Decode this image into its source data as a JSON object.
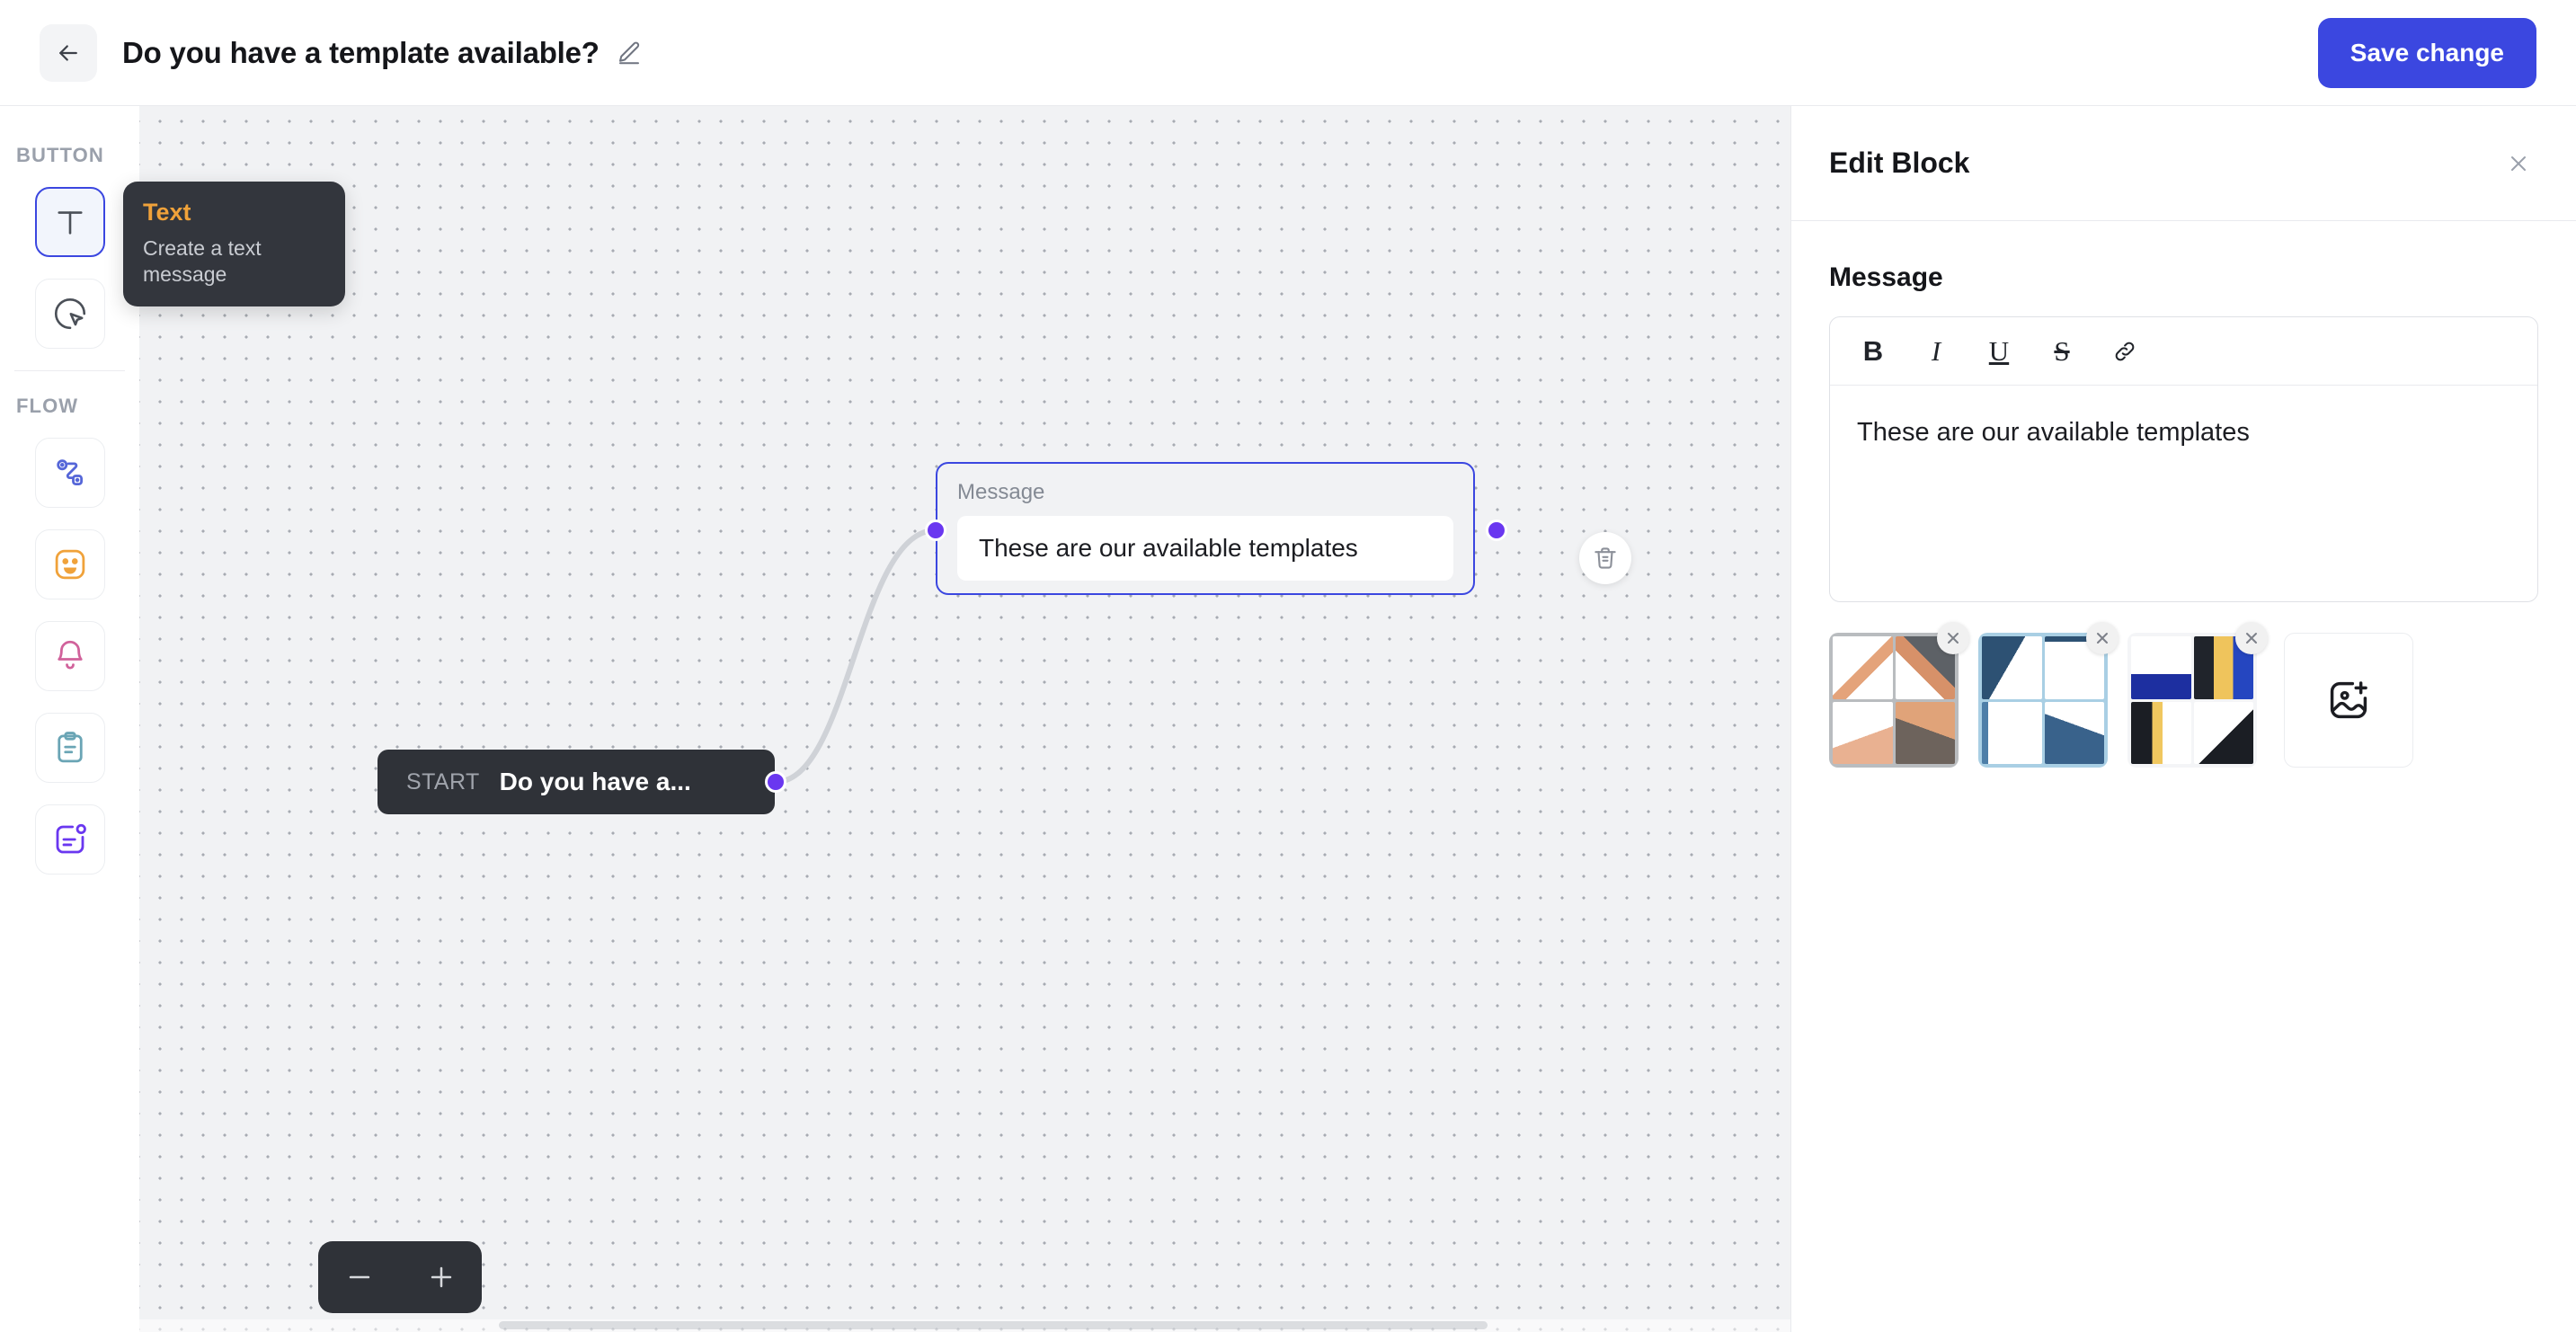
{
  "topbar": {
    "back_icon": "arrow-left-icon",
    "title": "Do you have a template available?",
    "edit_icon": "pencil-icon",
    "save_label": "Save change",
    "accent": "#3b47e0"
  },
  "rail": {
    "sections": [
      {
        "label": "BUTTON",
        "tools": [
          {
            "name": "text-tool",
            "icon": "text-t-icon",
            "active": true
          },
          {
            "name": "button-tool",
            "icon": "cursor-click-icon",
            "active": false
          }
        ]
      },
      {
        "label": "FLOW",
        "tools": [
          {
            "name": "flow-tool",
            "icon": "flow-path-icon",
            "active": false
          },
          {
            "name": "emoji-tool",
            "icon": "smiley-icon",
            "active": false
          },
          {
            "name": "notification-tool",
            "icon": "bell-icon",
            "active": false
          },
          {
            "name": "form-tool",
            "icon": "clipboard-icon",
            "active": false
          },
          {
            "name": "card-tool",
            "icon": "card-note-icon",
            "active": false
          }
        ]
      }
    ]
  },
  "tooltip": {
    "title": "Text",
    "description": "Create a text message",
    "title_color": "#f0a23a"
  },
  "canvas": {
    "start_node": {
      "tag": "START",
      "text": "Do you have a..."
    },
    "message_node": {
      "label": "Message",
      "text": "These are our available templates",
      "delete_icon": "trash-icon"
    },
    "zoom_controls": {
      "out_icon": "minus-icon",
      "in_icon": "plus-icon"
    }
  },
  "panel": {
    "title": "Edit Block",
    "close_icon": "close-icon",
    "field_label": "Message",
    "toolbar": [
      {
        "name": "bold-button",
        "label": "B",
        "icon": "bold-icon"
      },
      {
        "name": "italic-button",
        "label": "I",
        "icon": "italic-icon"
      },
      {
        "name": "underline-button",
        "label": "U",
        "icon": "underline-icon"
      },
      {
        "name": "strikethrough-button",
        "label": "S",
        "icon": "strikethrough-icon"
      },
      {
        "name": "link-button",
        "label": "",
        "icon": "link-icon"
      }
    ],
    "editor_text": "These are our available templates",
    "attachments": [
      {
        "name": "template-thumbnail-1",
        "remove_icon": "close-icon",
        "theme": "orange"
      },
      {
        "name": "template-thumbnail-2",
        "remove_icon": "close-icon",
        "theme": "blue"
      },
      {
        "name": "template-thumbnail-3",
        "remove_icon": "close-icon",
        "theme": "mixed"
      }
    ],
    "add_image": {
      "name": "add-image-button",
      "icon": "image-plus-icon"
    }
  }
}
